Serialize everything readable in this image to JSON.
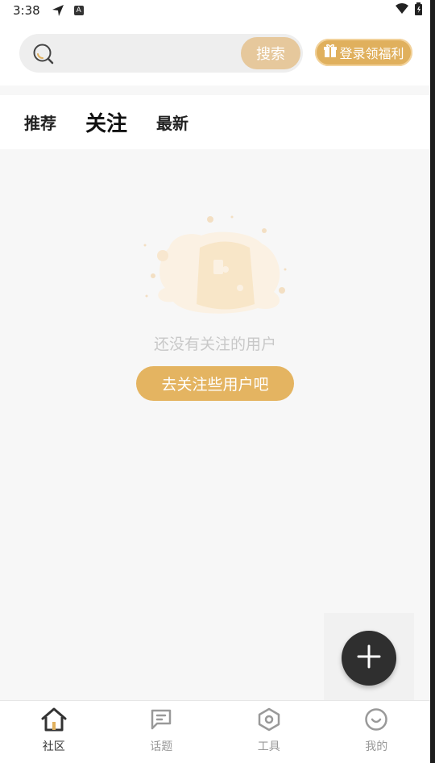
{
  "status_bar": {
    "time": "3:38"
  },
  "header": {
    "search": {
      "placeholder": "",
      "button_label": "搜索"
    },
    "login_badge": "登录领福利"
  },
  "tabs": [
    {
      "label": "推荐",
      "active": false
    },
    {
      "label": "关注",
      "active": true
    },
    {
      "label": "最新",
      "active": false
    }
  ],
  "empty_state": {
    "message": "还没有关注的用户",
    "action_label": "去关注些用户吧"
  },
  "bottom_nav": [
    {
      "label": "社区",
      "icon": "home-icon",
      "active": true
    },
    {
      "label": "话题",
      "icon": "topic-icon",
      "active": false
    },
    {
      "label": "工具",
      "icon": "tool-icon",
      "active": false
    },
    {
      "label": "我的",
      "icon": "profile-icon",
      "active": false
    }
  ],
  "colors": {
    "accent": "#e4b461",
    "accent_light": "#e6c89c",
    "fab": "#2f2f2f"
  }
}
